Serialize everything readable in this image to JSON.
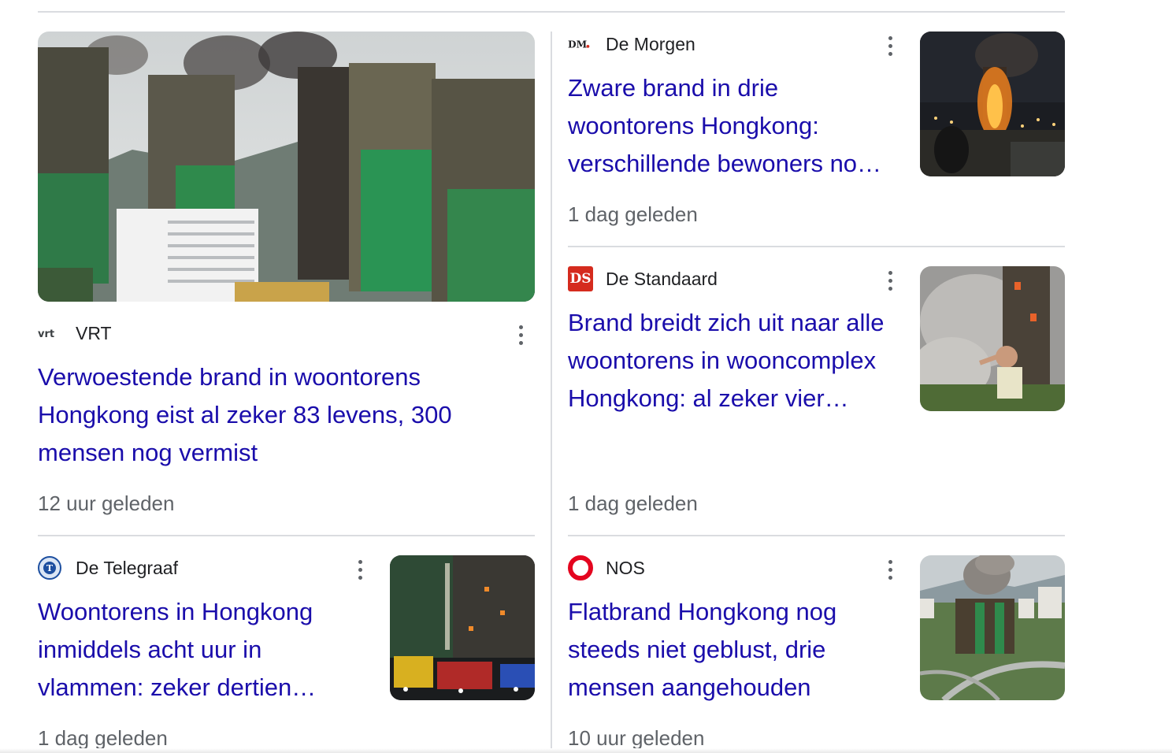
{
  "articles": [
    {
      "source": "VRT",
      "logo": "vrt-logo",
      "title_lines": [
        "Verwoestende brand in woontorens",
        "Hongkong eist al zeker 83 levens, 300",
        "mensen nog vermist"
      ],
      "time": "12 uur geleden",
      "image": "burning-towers-scaffolding"
    },
    {
      "source": "De Morgen",
      "logo": "dm-logo",
      "title_lines": [
        "Zware brand in drie",
        "woontorens Hongkong:",
        "verschillende bewoners no…"
      ],
      "time": "1 dag geleden",
      "image": "night-fire-onlookers"
    },
    {
      "source": "De Standaard",
      "logo": "ds-logo",
      "logo_text": "DS",
      "title_lines": [
        "Brand breidt zich uit naar alle",
        "woontorens in wooncomplex",
        "Hongkong: al zeker vier…"
      ],
      "time": "1 dag geleden",
      "image": "smoke-tower-man"
    },
    {
      "source": "De Telegraaf",
      "logo": "telegraaf-logo",
      "title_lines": [
        "Woontorens in Hongkong",
        "inmiddels acht uur in",
        "vlammen: zeker dertien…"
      ],
      "time": "1 dag geleden",
      "image": "fire-trucks-night"
    },
    {
      "source": "NOS",
      "logo": "nos-logo",
      "title_lines": [
        "Flatbrand Hongkong nog",
        "steeds niet geblust, drie",
        "mensen aangehouden"
      ],
      "time": "10 uur geleden",
      "image": "aerial-smoke-towers"
    }
  ],
  "colors": {
    "link": "#1a0dab",
    "meta": "#5f6368",
    "divider": "#dadce0",
    "ds_red": "#d52b1e",
    "nos_red": "#e4051f",
    "telegraaf_blue": "#1d4fa0"
  }
}
